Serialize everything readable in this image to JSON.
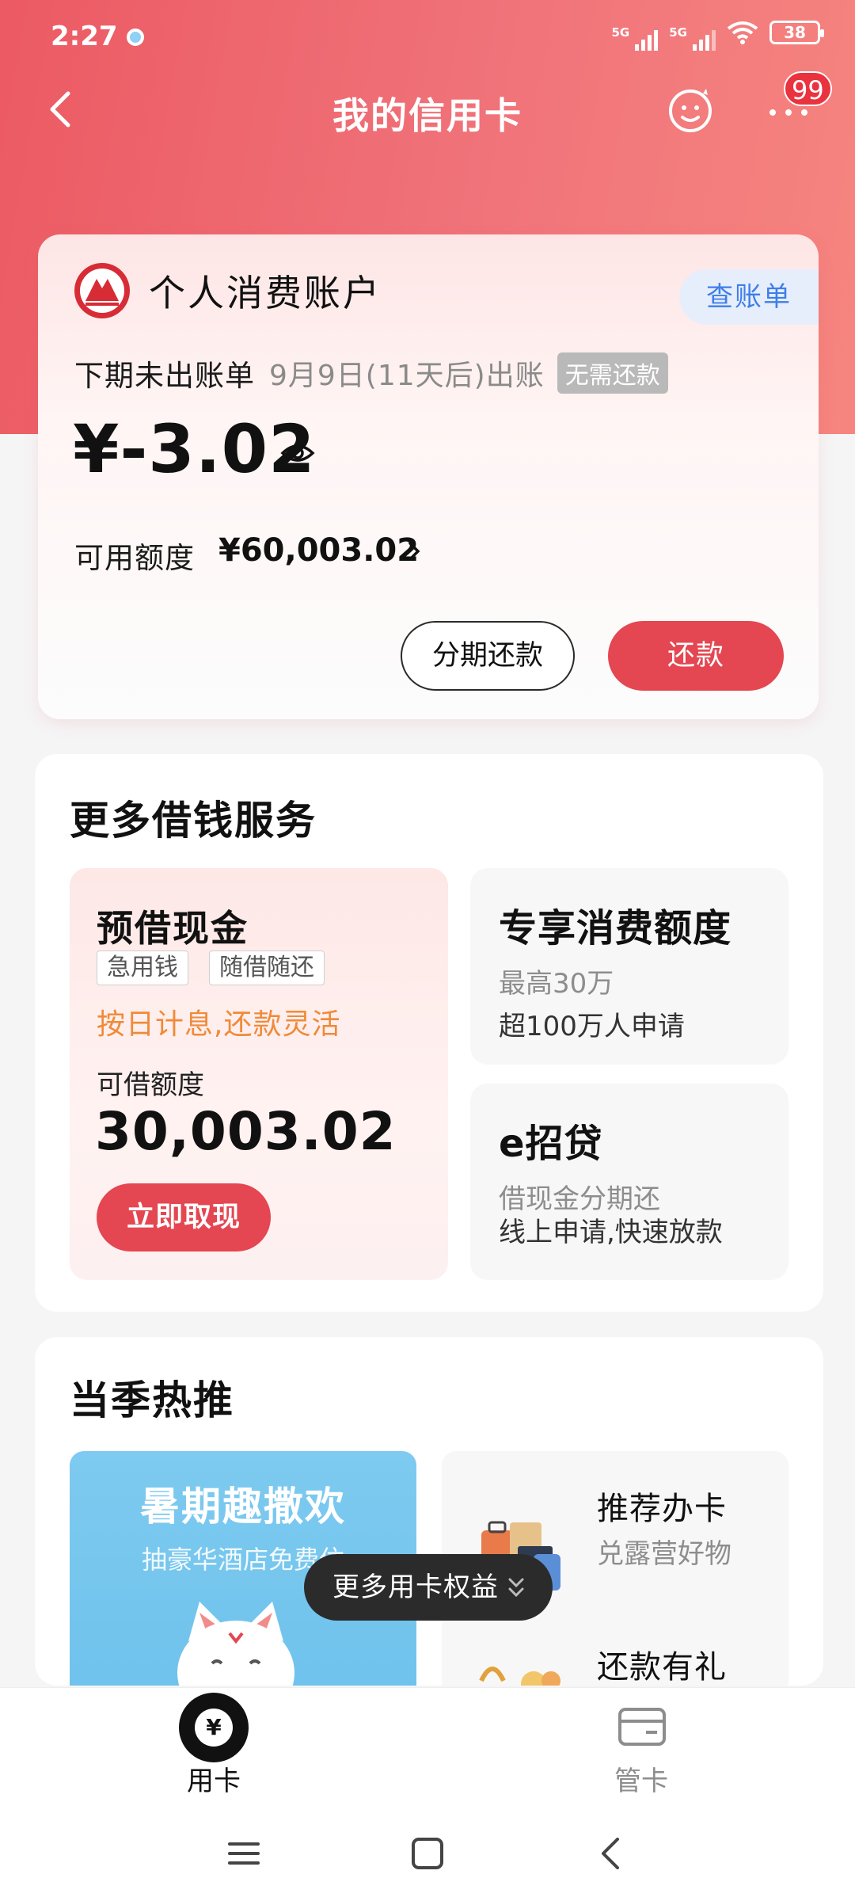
{
  "status_bar": {
    "time": "2:27",
    "signal_1": "5G",
    "signal_2": "5G",
    "battery": "38"
  },
  "header": {
    "title": "我的信用卡",
    "badge": "99"
  },
  "account": {
    "name": "个人消费账户",
    "statement_button": "查账单",
    "bill_label": "下期未出账单",
    "bill_date": "9月9日(11天后)出账",
    "bill_badge": "无需还款",
    "balance": "¥-3.02",
    "credit_label": "可用额度",
    "credit_value": "¥60,003.02",
    "installment_button": "分期还款",
    "repay_button": "还款"
  },
  "loan": {
    "title": "更多借钱服务",
    "cash": {
      "title": "预借现金",
      "tags": [
        "急用钱",
        "随借随还"
      ],
      "promo": "按日计息,还款灵活",
      "quota_label": "可借额度",
      "quota_value": "30,003.02",
      "button": "立即取现"
    },
    "exclusive": {
      "title": "专享消费额度",
      "sub1": "最高30万",
      "sub2": "超100万人申请"
    },
    "eloan": {
      "title": "e招贷",
      "sub1": "借现金分期还",
      "sub2": "线上申请,快速放款"
    }
  },
  "hot": {
    "title": "当季热推",
    "banner_title": "暑期趣撒欢",
    "banner_sub": "抽豪华酒店免费住",
    "rec1_title": "推荐办卡",
    "rec1_sub": "兑露营好物",
    "rec2_title": "还款有礼",
    "more_benefits": "更多用卡权益"
  },
  "tabs": {
    "use_card": "用卡",
    "manage_card": "管卡"
  },
  "colors": {
    "brand_red": "#e44652",
    "header_gradient_start": "#ec5a63",
    "link_blue": "#3f7ee8",
    "promo_orange": "#f08a38"
  }
}
